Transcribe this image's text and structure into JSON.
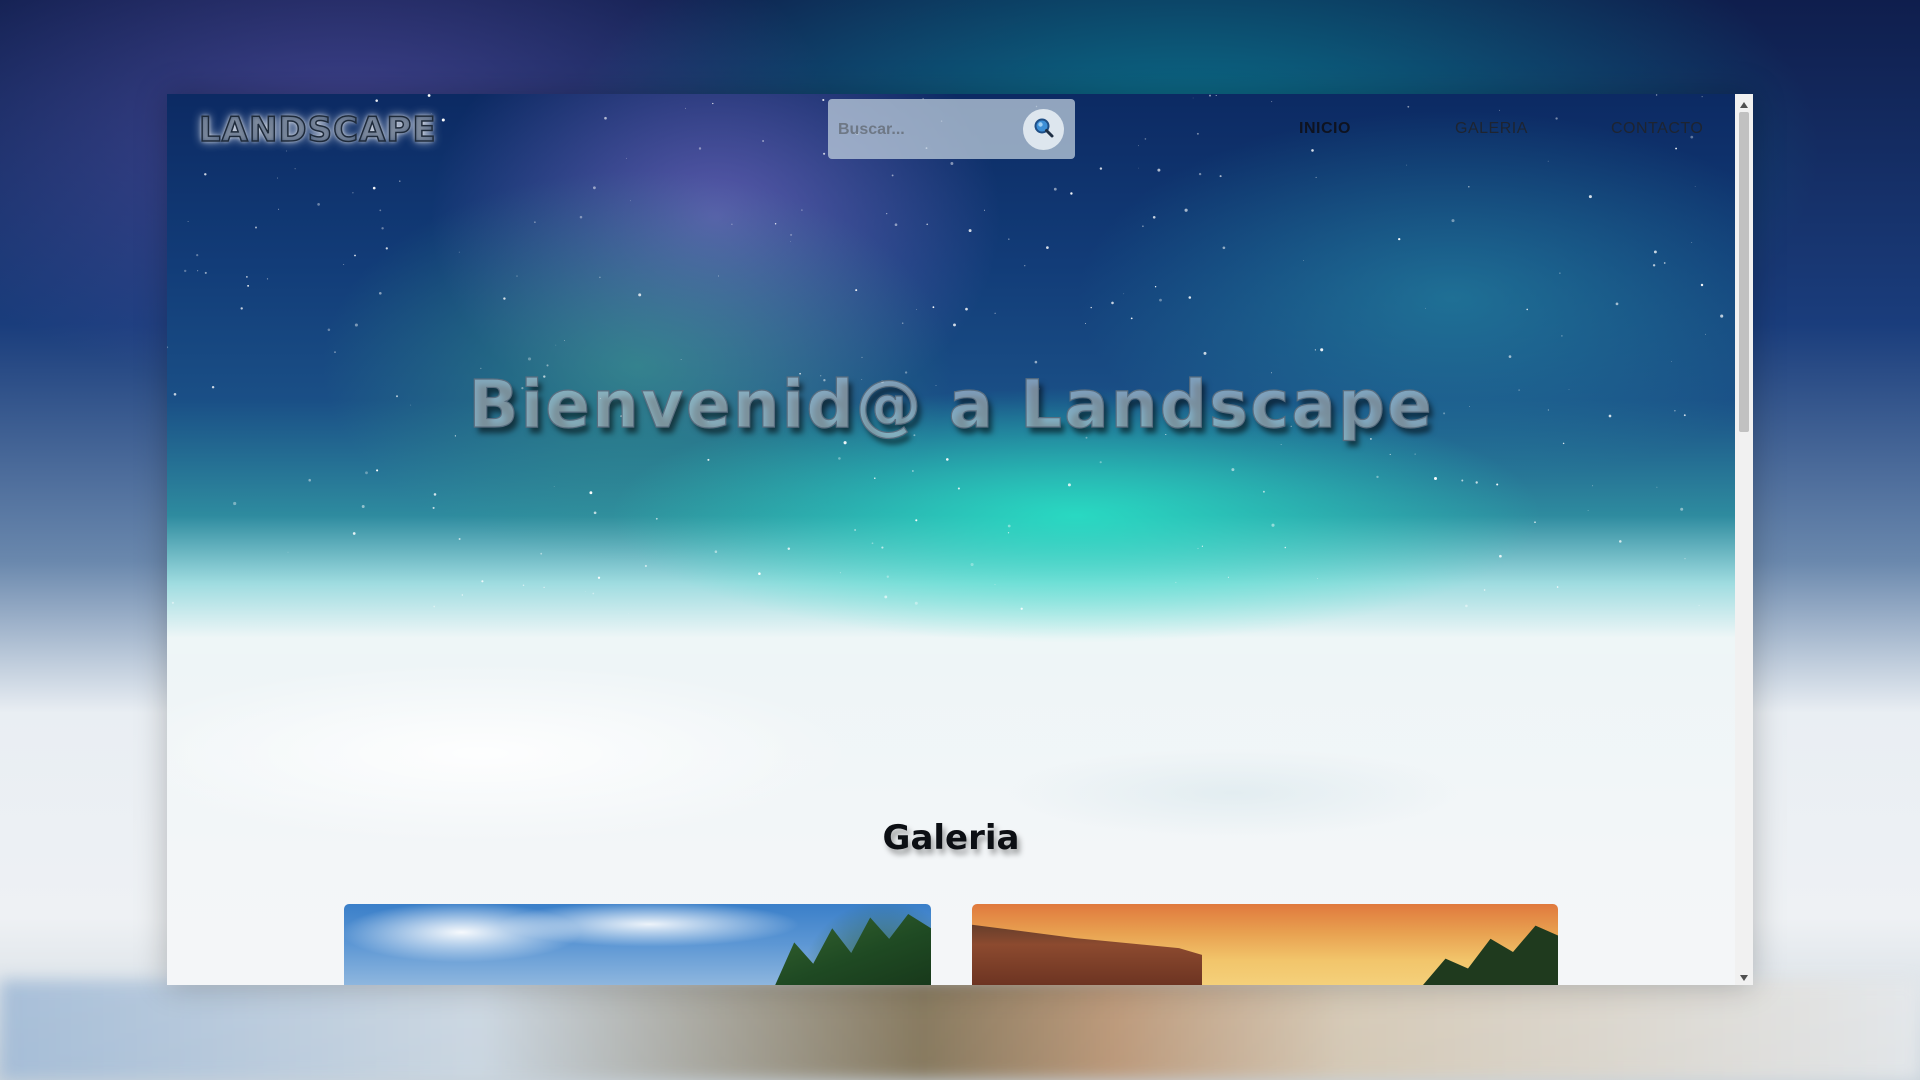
{
  "header": {
    "logo": "LANDSCAPE",
    "search": {
      "placeholder": "Buscar...",
      "icon": "search-icon"
    },
    "nav": [
      {
        "label": "INICIO",
        "active": true
      },
      {
        "label": "GALERIA",
        "active": false
      },
      {
        "label": "CONTACTO",
        "active": false
      }
    ]
  },
  "hero": {
    "title": "Bienvenid@ a Landscape"
  },
  "gallery": {
    "title": "Galeria"
  },
  "colors": {
    "aurora": "#2ee6c8",
    "night_sky": "#0c2a63",
    "snow": "#f4f6f8",
    "nav_text": "#1e2430"
  }
}
